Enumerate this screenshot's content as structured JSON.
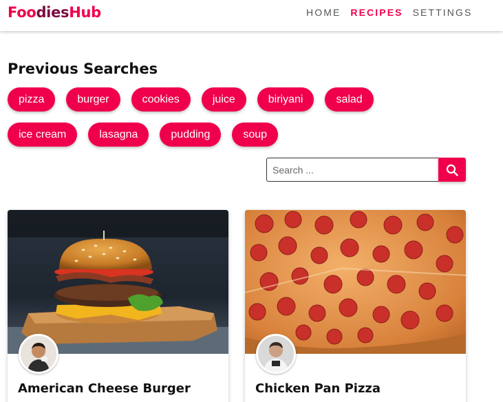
{
  "header": {
    "logo_part1": "Foo",
    "logo_part2": "dies",
    "logo_part3": "Hub",
    "nav": [
      "HOME",
      "RECIPES",
      "SETTINGS"
    ],
    "active_nav": "RECIPES"
  },
  "section_title": "Previous Searches",
  "previous_searches": {
    "row1": [
      "pizza",
      "burger",
      "cookies",
      "juice",
      "biriyani",
      "salad"
    ],
    "row2": [
      "ice cream",
      "lasagna",
      "pudding",
      "soup"
    ]
  },
  "search": {
    "placeholder": "Search ...",
    "value": "",
    "icon": "search-icon"
  },
  "cards": [
    {
      "title": "American Cheese Burger",
      "image": "burger-photo",
      "avatar": "chef-avatar"
    },
    {
      "title": "Chicken Pan Pizza",
      "image": "pizza-photo",
      "avatar": "chef-avatar"
    }
  ],
  "colors": {
    "accent": "#f0004c",
    "logo_mid": "#7a0a40",
    "nav_text": "#555555"
  }
}
